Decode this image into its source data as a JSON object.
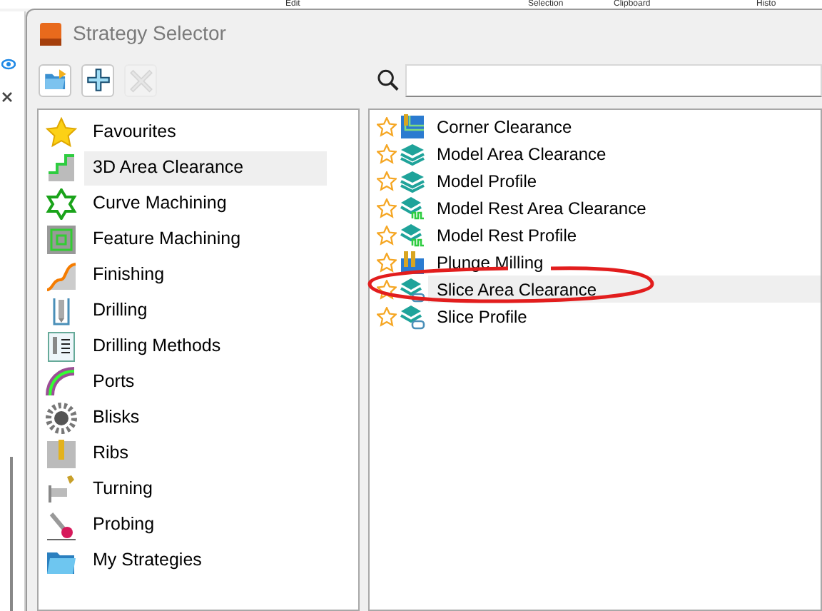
{
  "background_app": {
    "ribbon_groups": [
      "Edit",
      "Selection",
      "Clipboard",
      "Histo"
    ]
  },
  "dialog": {
    "title": "Strategy Selector",
    "toolbar": [
      {
        "kind": "open",
        "disabled": false
      },
      {
        "kind": "add",
        "disabled": false
      },
      {
        "kind": "delete",
        "disabled": true
      }
    ],
    "categories": [
      {
        "label": "Favourites",
        "kind": "star",
        "selected": false
      },
      {
        "label": "3D Area Clearance",
        "kind": "steps",
        "selected": true
      },
      {
        "label": "Curve Machining",
        "kind": "curve",
        "selected": false
      },
      {
        "label": "Feature Machining",
        "kind": "feature",
        "selected": false
      },
      {
        "label": "Finishing",
        "kind": "finish",
        "selected": false
      },
      {
        "label": "Drilling",
        "kind": "drill",
        "selected": false
      },
      {
        "label": "Drilling Methods",
        "kind": "drillmethods",
        "selected": false
      },
      {
        "label": "Ports",
        "kind": "port",
        "selected": false
      },
      {
        "label": "Blisks",
        "kind": "blisk",
        "selected": false
      },
      {
        "label": "Ribs",
        "kind": "rib",
        "selected": false
      },
      {
        "label": "Turning",
        "kind": "turn",
        "selected": false
      },
      {
        "label": "Probing",
        "kind": "probe",
        "selected": false
      },
      {
        "label": "My Strategies",
        "kind": "folder",
        "selected": false
      }
    ],
    "strategies": [
      {
        "label": "Corner Clearance",
        "kind": "corner",
        "selected": false
      },
      {
        "label": "Model Area Clearance",
        "kind": "layers",
        "selected": false
      },
      {
        "label": "Model Profile",
        "kind": "layers",
        "selected": false
      },
      {
        "label": "Model Rest Area Clearance",
        "kind": "rest",
        "selected": false
      },
      {
        "label": "Model Rest Profile",
        "kind": "rest",
        "selected": false
      },
      {
        "label": "Plunge Milling",
        "kind": "plunge",
        "selected": false
      },
      {
        "label": "Slice Area Clearance",
        "kind": "slice",
        "selected": true
      },
      {
        "label": "Slice Profile",
        "kind": "slice",
        "selected": false
      }
    ]
  }
}
